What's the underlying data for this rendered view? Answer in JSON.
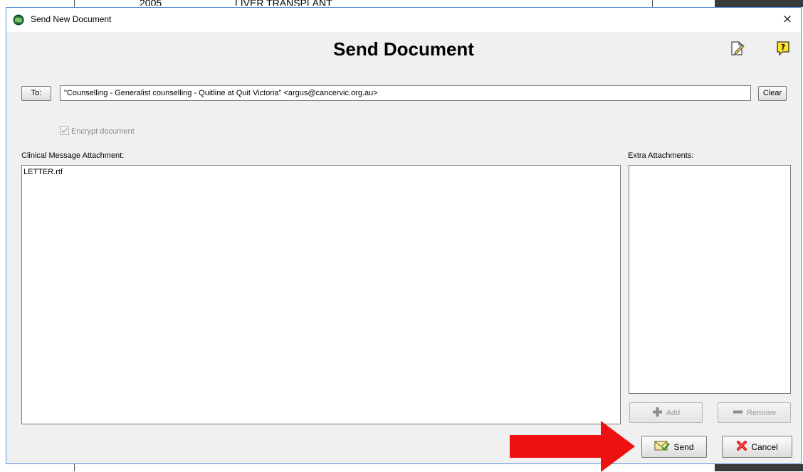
{
  "background": {
    "fragment_left": "2005",
    "fragment_right": "LIVER TRANSPLANT"
  },
  "window": {
    "title": "Send New Document",
    "close_symbol": "×",
    "app_icon": "globe-icon"
  },
  "heading": "Send Document",
  "top_icons": [
    "edit-document-icon",
    "help-icon"
  ],
  "to": {
    "button_label": "To:",
    "value": "\"Counselling - Generalist counselling - Quitline at Quit Victoria\" <argus@cancervic.org.au>",
    "clear_label": "Clear"
  },
  "encrypt": {
    "label": "Encrypt document",
    "checked": true,
    "enabled": false
  },
  "clinical": {
    "label": "Clinical Message Attachment:",
    "items": [
      "LETTER.rtf"
    ]
  },
  "extra": {
    "label": "Extra Attachments:",
    "items": [],
    "add_label": "Add",
    "remove_label": "Remove"
  },
  "actions": {
    "send_label": "Send",
    "cancel_label": "Cancel"
  },
  "colors": {
    "dialog_bg": "#f0f0f0",
    "dialog_border": "#5b8fd6",
    "arrow": "#ee1111"
  }
}
